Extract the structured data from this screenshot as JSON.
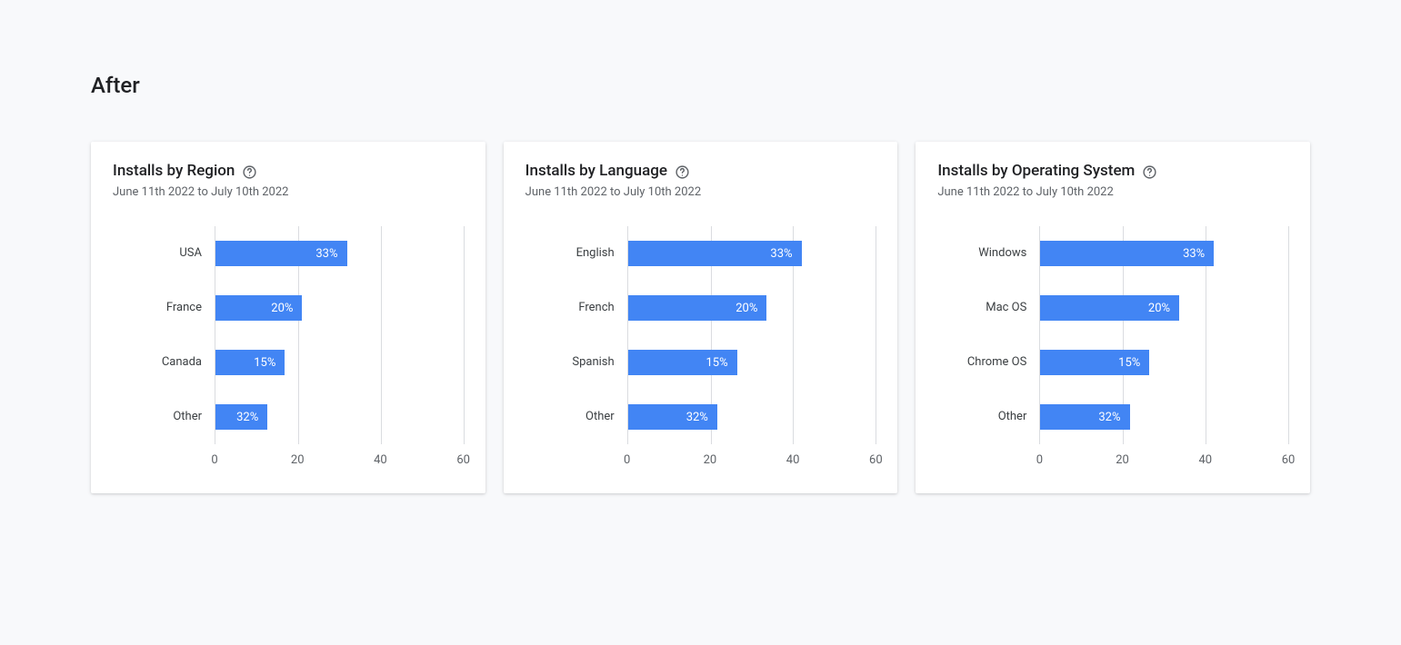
{
  "page_title": "After",
  "date_range": "June 11th 2022 to July 10th 2022",
  "axis_ticks": [
    0,
    20,
    40,
    60
  ],
  "axis_max": 60,
  "cards": [
    {
      "id": "region",
      "title": "Installs by Region",
      "categories": [
        "USA",
        "France",
        "Canada",
        "Other"
      ],
      "values": [
        33,
        20,
        15,
        32
      ],
      "value_labels": [
        "33%",
        "20%",
        "15%",
        "32%"
      ],
      "bar_pct": [
        53,
        35,
        28,
        21
      ]
    },
    {
      "id": "language",
      "title": "Installs by Language",
      "categories": [
        "English",
        "French",
        "Spanish",
        "Other"
      ],
      "values": [
        33,
        20,
        15,
        32
      ],
      "value_labels": [
        "33%",
        "20%",
        "15%",
        "32%"
      ],
      "bar_pct": [
        70,
        56,
        44,
        36
      ]
    },
    {
      "id": "os",
      "title": "Installs by Operating System",
      "categories": [
        "Windows",
        "Mac OS",
        "Chrome OS",
        "Other"
      ],
      "values": [
        33,
        20,
        15,
        32
      ],
      "value_labels": [
        "33%",
        "20%",
        "15%",
        "32%"
      ],
      "bar_pct": [
        70,
        56,
        44,
        36
      ]
    }
  ],
  "chart_data": [
    {
      "type": "bar",
      "orientation": "horizontal",
      "title": "Installs by Region",
      "subtitle": "June 11th 2022 to July 10th 2022",
      "categories": [
        "USA",
        "France",
        "Canada",
        "Other"
      ],
      "values": [
        33,
        20,
        15,
        32
      ],
      "value_suffix": "%",
      "xlim": [
        0,
        60
      ],
      "xticks": [
        0,
        20,
        40,
        60
      ]
    },
    {
      "type": "bar",
      "orientation": "horizontal",
      "title": "Installs by Language",
      "subtitle": "June 11th 2022 to July 10th 2022",
      "categories": [
        "English",
        "French",
        "Spanish",
        "Other"
      ],
      "values": [
        33,
        20,
        15,
        32
      ],
      "value_suffix": "%",
      "xlim": [
        0,
        60
      ],
      "xticks": [
        0,
        20,
        40,
        60
      ]
    },
    {
      "type": "bar",
      "orientation": "horizontal",
      "title": "Installs by Operating System",
      "subtitle": "June 11th 2022 to July 10th 2022",
      "categories": [
        "Windows",
        "Mac OS",
        "Chrome OS",
        "Other"
      ],
      "values": [
        33,
        20,
        15,
        32
      ],
      "value_suffix": "%",
      "xlim": [
        0,
        60
      ],
      "xticks": [
        0,
        20,
        40,
        60
      ]
    }
  ]
}
